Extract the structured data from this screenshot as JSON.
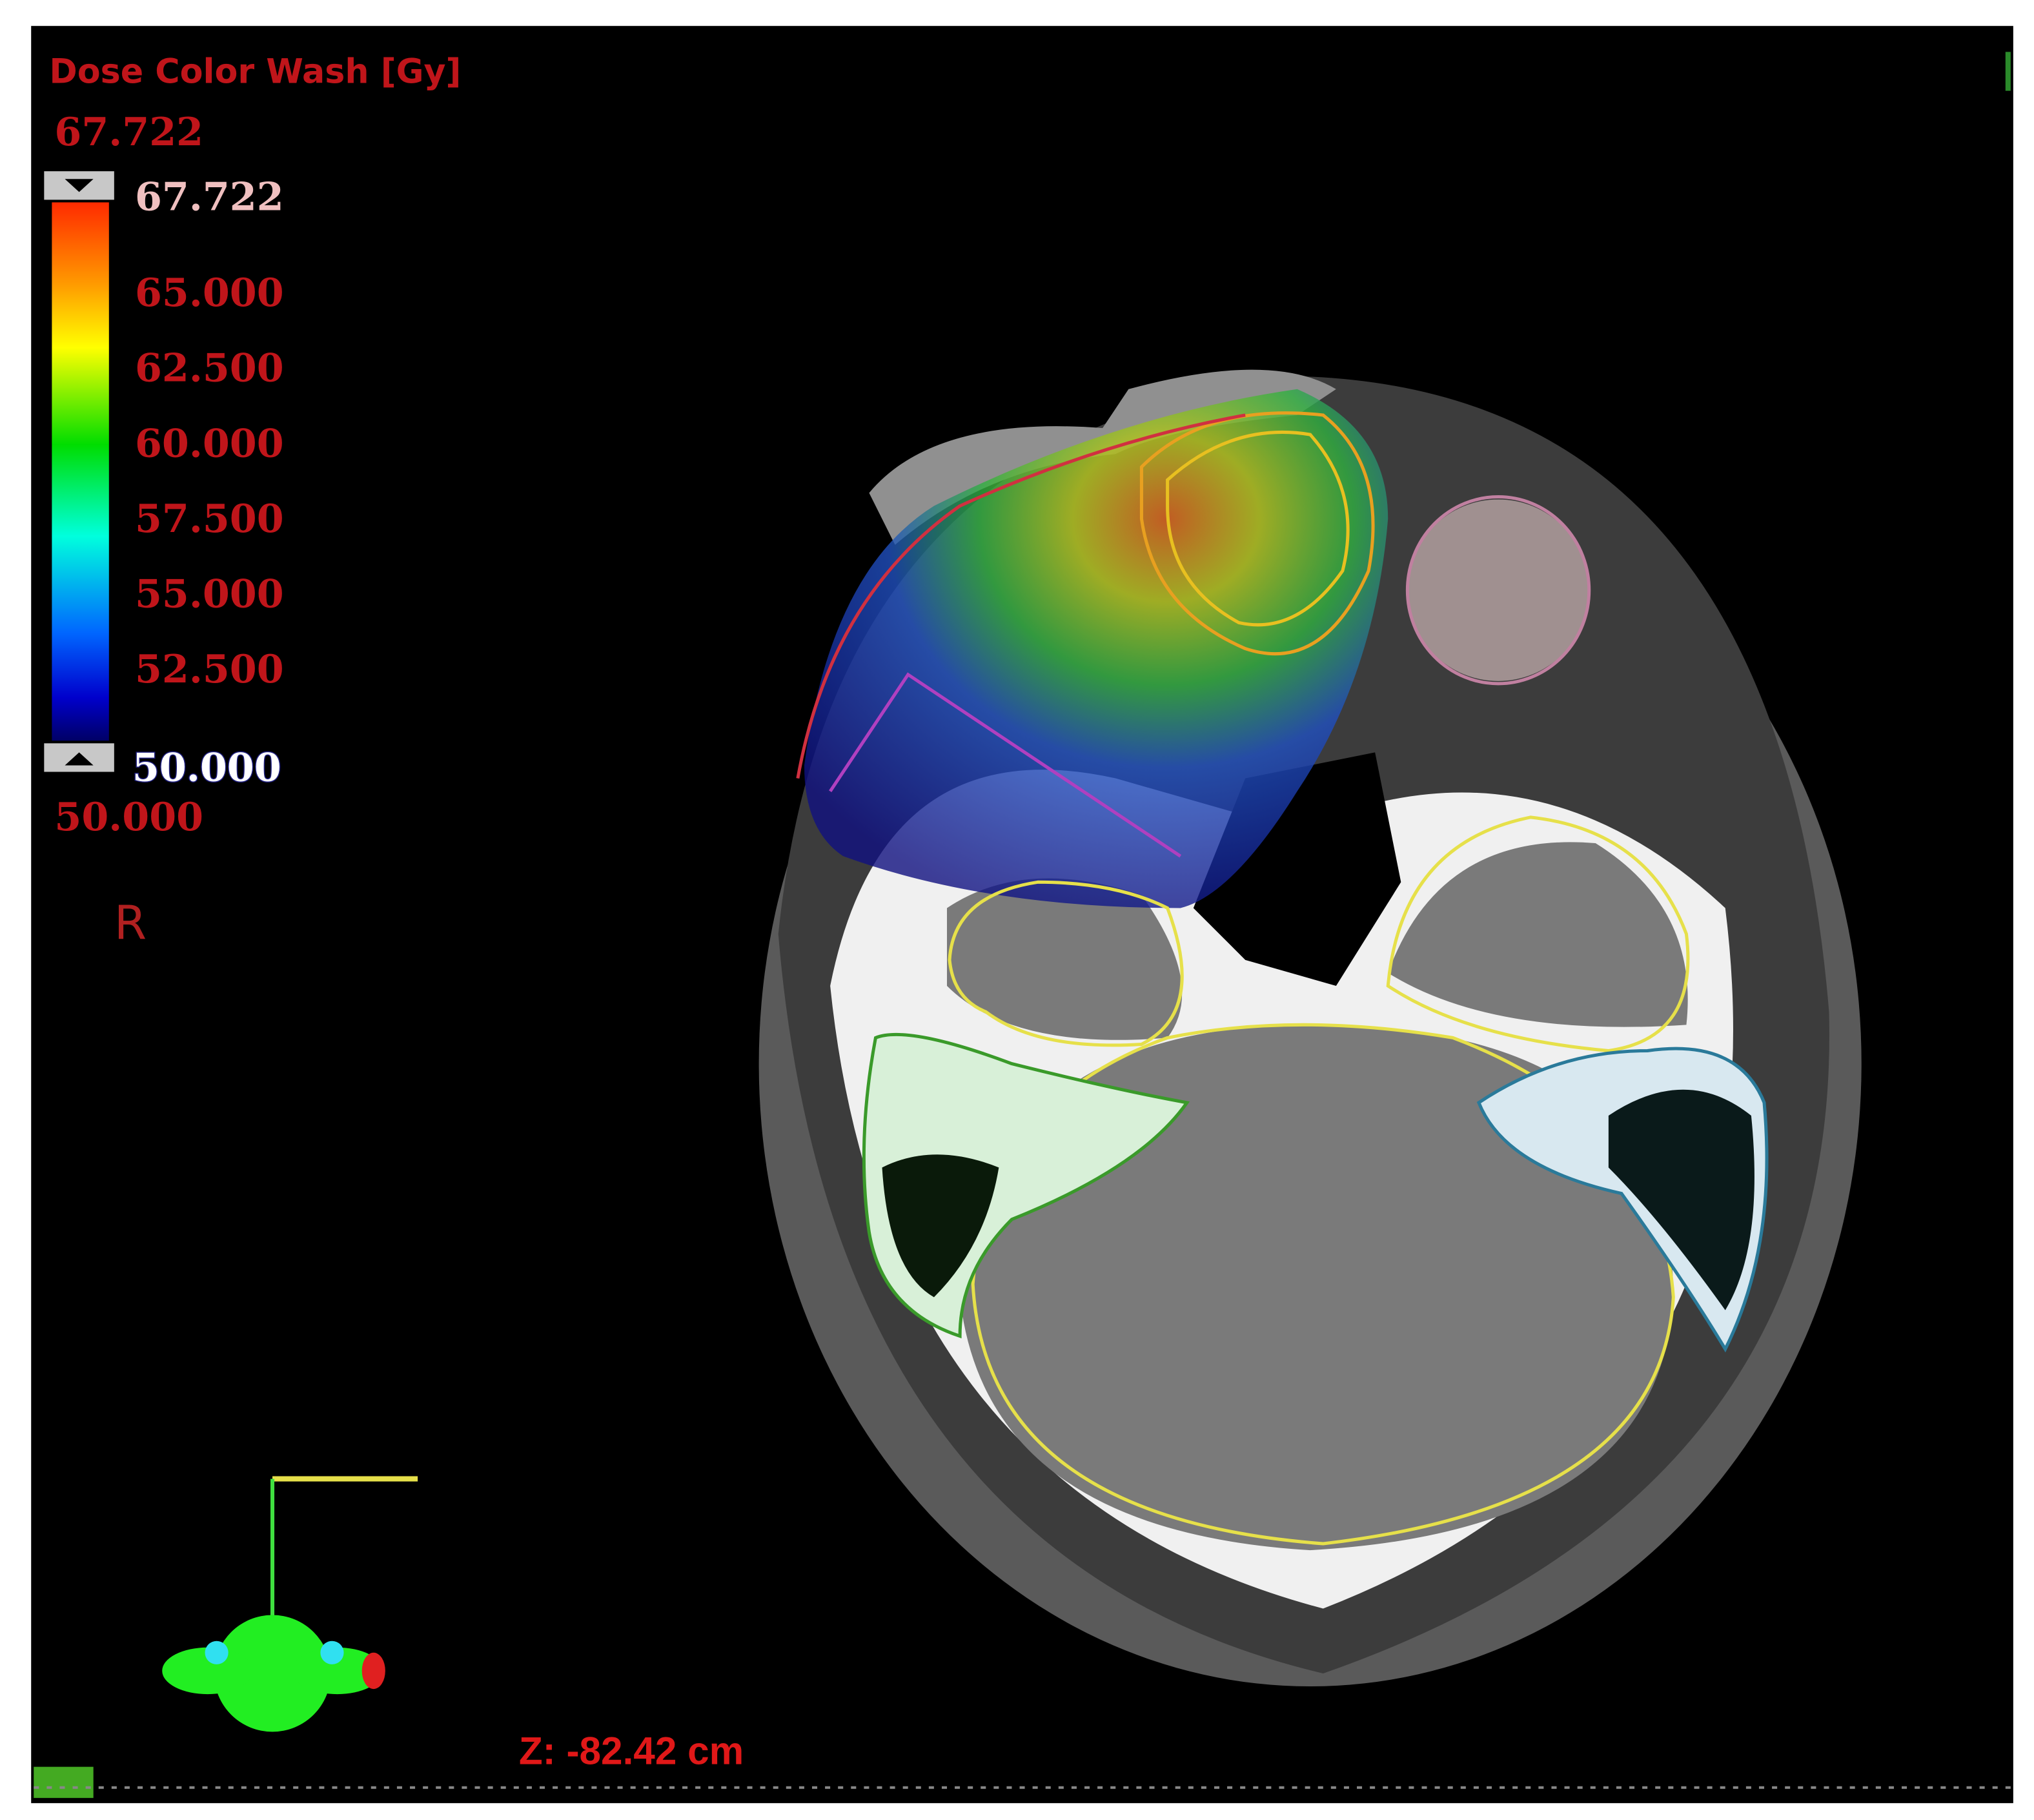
{
  "dose_legend": {
    "title": "Dose Color Wash [Gy]",
    "max_value": "67.722",
    "upper_threshold": "67.722",
    "ticks": [
      "65.000",
      "62.500",
      "60.000",
      "57.500",
      "55.000",
      "52.500"
    ],
    "lower_threshold": "50.000",
    "min_value": "50.000",
    "colors": [
      "#ff2a00",
      "#ff9900",
      "#ffff00",
      "#00dd00",
      "#00ffdd",
      "#0066ff",
      "#0000cc",
      "#000066"
    ]
  },
  "orientation_label": "R",
  "slice_position": "Z: -82.42 cm",
  "colors": {
    "label_red": "#c0151a",
    "background": "#000000",
    "brain_contour": "#e6e04a",
    "left_ear_contour": "#3a9a2a",
    "right_ear_contour": "#2a7a9a"
  }
}
